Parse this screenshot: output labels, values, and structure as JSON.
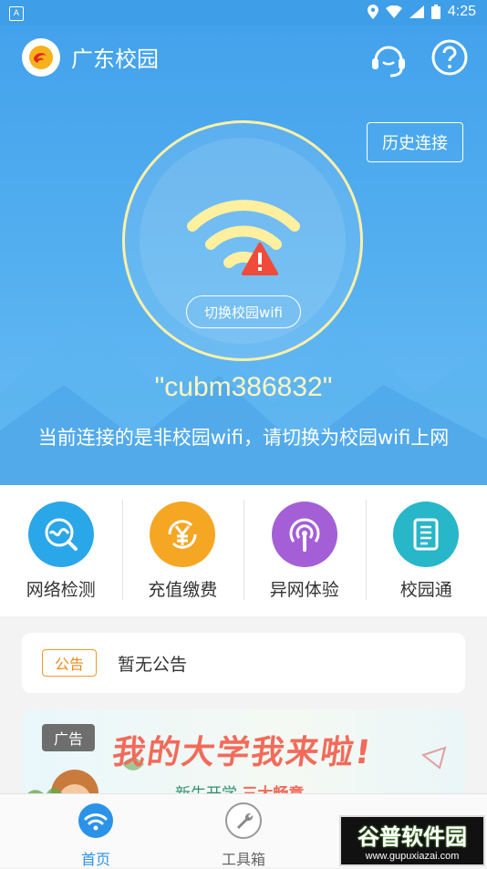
{
  "status_bar": {
    "time": "4:25",
    "left_badge": "A"
  },
  "app": {
    "title": "广东校园"
  },
  "hero": {
    "history_button": "历史连接",
    "switch_button": "切换校园wifi",
    "ssid": "\"cubm386832\"",
    "message": "当前连接的是非校园wifi，请切换为校园wifi上网"
  },
  "features": [
    {
      "label": "网络检测",
      "icon": "network-test-icon",
      "color": "#2aa7e8"
    },
    {
      "label": "充值缴费",
      "icon": "recharge-yen-icon",
      "color": "#f5a623"
    },
    {
      "label": "异网体验",
      "icon": "podcast-icon",
      "color": "#a45fd6"
    },
    {
      "label": "校园通",
      "icon": "document-icon",
      "color": "#28b6c9"
    }
  ],
  "notice": {
    "badge": "公告",
    "text": "暂无公告"
  },
  "banner": {
    "badge": "广告",
    "headline": "我的大学我来啦!",
    "sub_prefix": "新生开学",
    "sub_highlight": "三大畅意"
  },
  "bottom_nav": [
    {
      "label": "首页",
      "active": true
    },
    {
      "label": "工具箱",
      "active": false
    }
  ],
  "watermark": {
    "title": "谷普软件园",
    "url": "www.gupuxiazai.com"
  },
  "colors": {
    "primary": "#43a2ec",
    "accent_yellow": "#fff6bf",
    "warning": "#f04b3a",
    "notice_orange": "#f39a2a"
  }
}
